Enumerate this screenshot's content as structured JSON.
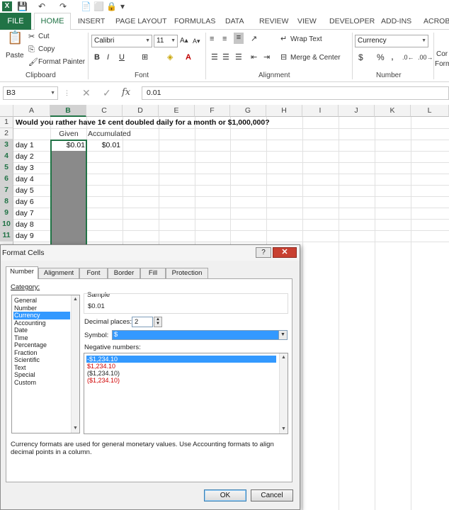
{
  "app": {
    "logo": "X",
    "logo_color": "#217346",
    "accent": "#217346"
  },
  "quick_access": [
    "💾",
    "↶",
    "↷",
    "📄",
    "⬜",
    "🔒",
    "▾"
  ],
  "ribbon_tabs": [
    "FILE",
    "HOME",
    "INSERT",
    "PAGE LAYOUT",
    "FORMULAS",
    "DATA",
    "REVIEW",
    "VIEW",
    "DEVELOPER",
    "ADD-INS",
    "ACROBA"
  ],
  "ribbon": {
    "clipboard": {
      "paste": "Paste",
      "cut": "Cut",
      "copy": "Copy",
      "format_painter": "Format Painter",
      "label": "Clipboard"
    },
    "font": {
      "name": "Calibri",
      "size": "11",
      "bold": "B",
      "italic": "I",
      "underline": "U",
      "label": "Font"
    },
    "alignment": {
      "wrap": "Wrap Text",
      "merge": "Merge & Center",
      "label": "Alignment"
    },
    "number": {
      "format": "Currency",
      "dollar": "$",
      "percent": "%",
      "comma": ",",
      "label": "Number"
    },
    "styles_cut": {
      "line1": "Cor",
      "line2": "Form"
    }
  },
  "formula_bar": {
    "name_box": "B3",
    "fx": "fx",
    "value": "0.01"
  },
  "columns": [
    "A",
    "B",
    "C",
    "D",
    "E",
    "F",
    "G",
    "H",
    "I",
    "J",
    "K",
    "L"
  ],
  "rows": [
    "1",
    "2",
    "3",
    "4",
    "5",
    "6",
    "7",
    "8",
    "9",
    "10",
    "11"
  ],
  "sheet": {
    "title": "Would you rather have 1¢ cent doubled daily for a month or $1,000,000?",
    "given": "Given",
    "accumulated": "Accumulated",
    "b3": "$0.01",
    "c3": "$0.01",
    "days": [
      "day 1",
      "day 2",
      "day 3",
      "day 4",
      "day 5",
      "day 6",
      "day 7",
      "day 8",
      "day 9"
    ]
  },
  "dialog": {
    "title": "Format Cells",
    "help": "?",
    "close": "✕",
    "tabs": [
      "Number",
      "Alignment",
      "Font",
      "Border",
      "Fill",
      "Protection"
    ],
    "category_label": "Category:",
    "categories": [
      "General",
      "Number",
      "Currency",
      "Accounting",
      "Date",
      "Time",
      "Percentage",
      "Fraction",
      "Scientific",
      "Text",
      "Special",
      "Custom"
    ],
    "selected_category": "Currency",
    "sample_label": "Sample",
    "sample_value": "$0.01",
    "decimal_label": "Decimal places:",
    "decimal_value": "2",
    "symbol_label": "Symbol:",
    "symbol_value": "$",
    "negative_label": "Negative numbers:",
    "negative_options": [
      "-$1,234.10",
      "$1,234.10",
      "($1,234.10)",
      "($1,234.10)"
    ],
    "description": "Currency formats are used for general monetary values.  Use Accounting formats to align decimal points in a column.",
    "ok": "OK",
    "cancel": "Cancel"
  }
}
